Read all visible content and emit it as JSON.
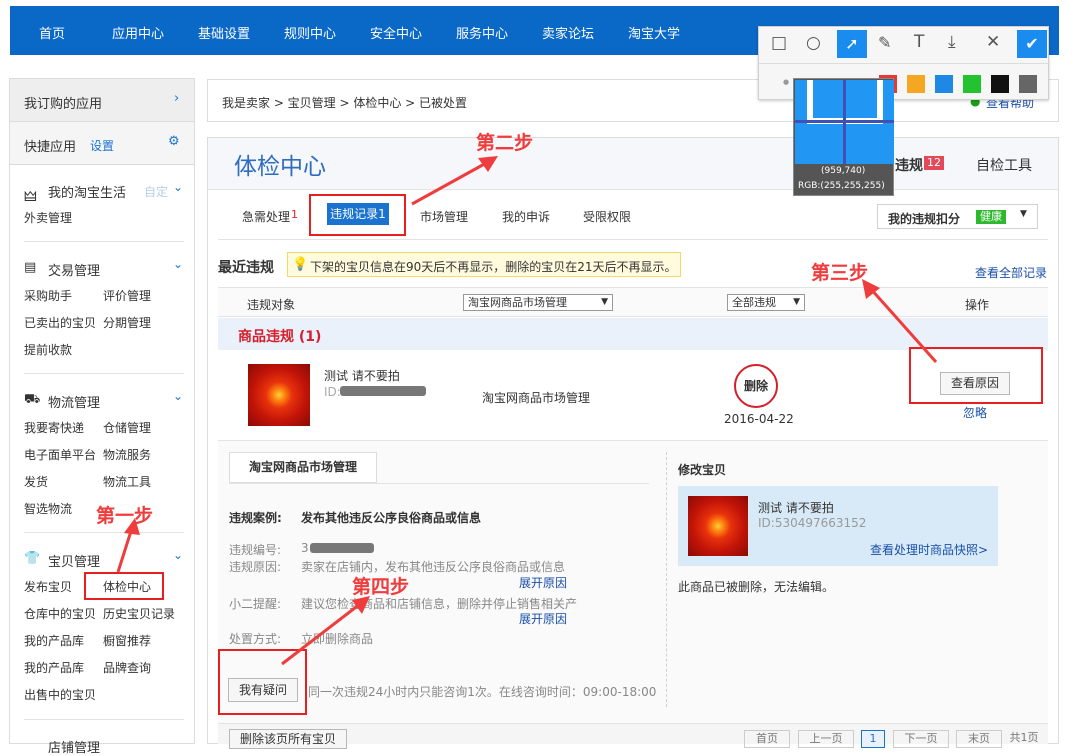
{
  "topnav": {
    "items": [
      "首页",
      "应用中心",
      "基础设置",
      "规则中心",
      "安全中心",
      "服务中心",
      "卖家论坛",
      "淘宝大学"
    ]
  },
  "sidebar": {
    "subscribed": "我订购的应用",
    "quick": "快捷应用",
    "settings": "设置",
    "life": {
      "title": "我的淘宝生活",
      "items": [
        "外卖管理"
      ],
      "ghost": "自定"
    },
    "trade": {
      "title": "交易管理",
      "items": [
        "采购助手",
        "评价管理",
        "已卖出的宝贝",
        "分期管理",
        "提前收款"
      ]
    },
    "logistics": {
      "title": "物流管理",
      "items": [
        "我要寄快递",
        "仓储管理",
        "电子面单平台",
        "物流服务",
        "发货",
        "物流工具",
        "智选物流"
      ]
    },
    "goods": {
      "title": "宝贝管理",
      "items": [
        "发布宝贝",
        "体检中心",
        "仓库中的宝贝",
        "历史宝贝记录",
        "我的产品库",
        "橱窗推荐",
        "我的产品库",
        "品牌查询",
        "出售中的宝贝"
      ]
    },
    "bottom_partial": "店铺管理"
  },
  "breadcrumb": "我是卖家 > 宝贝管理 > 体检中心 > 已被处置",
  "help": "查看帮助",
  "page_title": "体检中心",
  "right_tabs": {
    "violation": "违规",
    "violation_count": "12",
    "selfcheck": "自检工具"
  },
  "tabs": [
    {
      "label": "急需处理",
      "count": "1"
    },
    {
      "label": "违规记录1"
    },
    {
      "label": "市场管理"
    },
    {
      "label": "我的申诉"
    },
    {
      "label": "受限权限"
    }
  ],
  "score": {
    "label": "我的违规扣分",
    "status": "健康"
  },
  "recent": {
    "title": "最近违规",
    "tip": "下架的宝贝信息在90天后不再显示，删除的宝贝在21天后不再显示。",
    "view_all": "查看全部记录"
  },
  "table_head": {
    "object": "违规对象",
    "market": "淘宝网商品市场管理",
    "all": "全部违规",
    "op": "操作"
  },
  "group": {
    "title": "商品违规 (1)"
  },
  "row": {
    "name": "测试 请不要拍",
    "id_label": "ID:",
    "source": "淘宝网商品市场管理",
    "stamp": "删除",
    "date": "2016-04-22",
    "reason_btn": "查看原因",
    "ignore": "忽略"
  },
  "detail": {
    "tag": "淘宝网商品市场管理",
    "case_label": "违规案例:",
    "case_text": "发布其他违反公序良俗商品或信息",
    "num_label": "违规编号:",
    "num_val": "3",
    "reason_label": "违规原因:",
    "reason_val": "卖家在店铺内，发布其他违反公序良俗商品或信息",
    "expand": "展开原因",
    "tip_label": "小二提醒:",
    "tip_val": "建议您检查商品和店铺信息，删除并停止销售相关产",
    "method_label": "处置方式:",
    "method_val": "立即删除商品",
    "question_btn": "我有疑问",
    "question_note": "同一次违规24小时内只能咨询1次。在线咨询时间：09:00-18:00"
  },
  "edit": {
    "title": "修改宝贝",
    "name": "测试 请不要拍",
    "id": "ID:530497663152",
    "snapshot": "查看处理时商品快照>",
    "note": "此商品已被删除，无法编辑。"
  },
  "bulk_btn": "删除该页所有宝贝",
  "pager": {
    "first": "首页",
    "prev": "上一页",
    "cur": "1",
    "next": "下一页",
    "last": "末页",
    "total": "共1页"
  },
  "annotations": {
    "step1": "第一步",
    "step2": "第二步",
    "step3": "第三步",
    "step4": "第四步"
  },
  "screenshot_tool": {
    "coords": "(959,740)",
    "rgb": "RGB:(255,255,255)",
    "palette": [
      "#e53935",
      "#f5a623",
      "#1e88e5",
      "#22c32e",
      "#111111",
      "#666666"
    ]
  }
}
